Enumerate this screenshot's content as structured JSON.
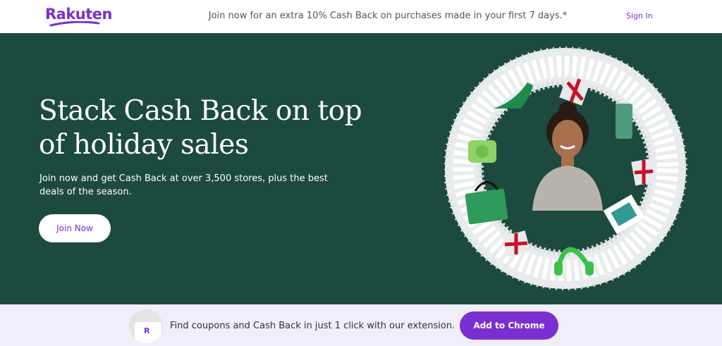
{
  "header": {
    "logo_text": "Rakuten",
    "promo_text": "Join now for an extra 10% Cash Back on purchases made in your first 7 days.*",
    "signin_label": "Sign In",
    "brand_color": "#7b2fd1"
  },
  "hero": {
    "title": "Stack Cash Back on top of holiday sales",
    "subtitle": "Join now and get Cash Back at over 3,500 stores, plus the best deals of the season.",
    "join_label": "Join Now",
    "background_color": "#1c4a3f",
    "image_alt": "holiday-wreath-with-woman-and-gifts"
  },
  "extension_bar": {
    "icon_letter": "R",
    "message": "Find coupons and Cash Back in just 1 click with our extension.",
    "button_label": "Add to Chrome",
    "background_color": "#f1eefc"
  }
}
